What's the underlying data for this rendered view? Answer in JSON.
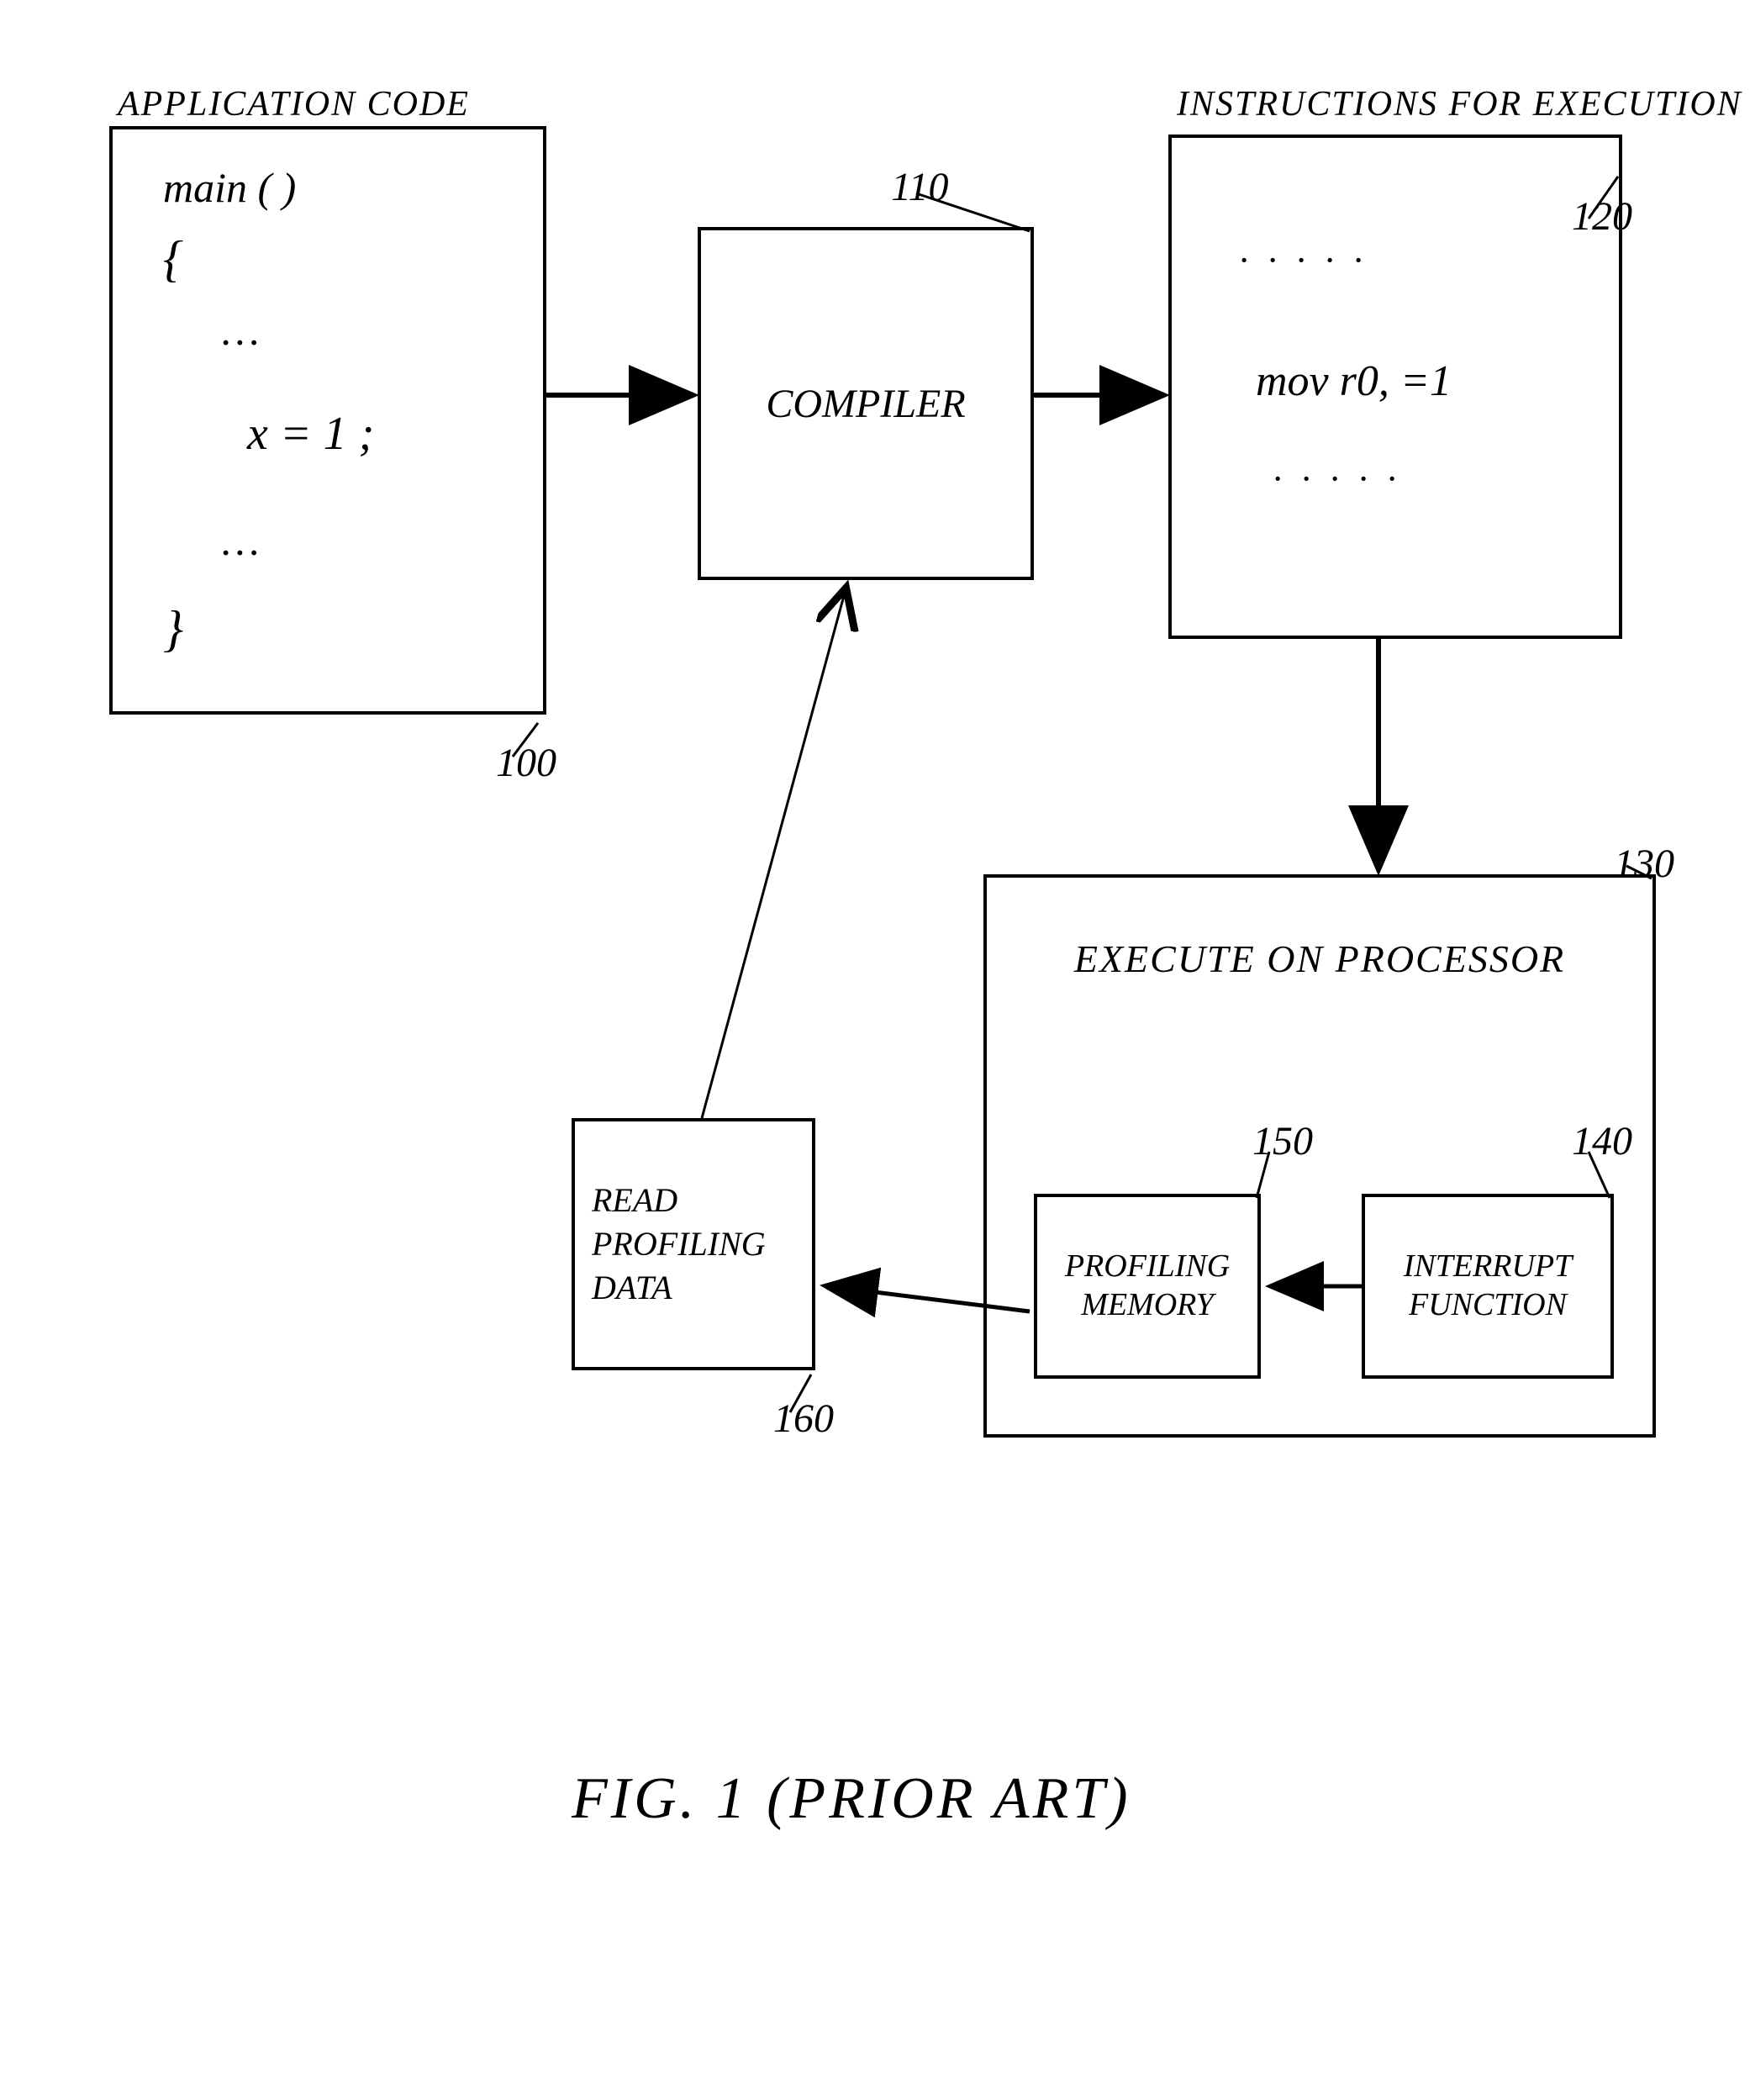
{
  "labels": {
    "app_code_title": "APPLICATION CODE",
    "instructions_title": "INSTRUCTIONS FOR EXECUTION"
  },
  "boxes": {
    "app_code": {
      "main_decl": "main ( )",
      "brace_open": "{",
      "dots1": "…",
      "assign": "x = 1 ;",
      "dots2": "…",
      "brace_close": "}"
    },
    "compiler": "COMPILER",
    "instructions": {
      "dots_top": "· · · · ·",
      "mov": "mov r0, =1",
      "dots_bot": "· · · · ·"
    },
    "processor_title": "EXECUTE ON PROCESSOR",
    "prof_mem": "PROFILING MEMORY",
    "interrupt": "INTERRUPT FUNCTION",
    "read_prof": "READ PROFILING DATA"
  },
  "refs": {
    "r100": "100",
    "r110": "110",
    "r120": "120",
    "r130": "130",
    "r140": "140",
    "r150": "150",
    "r160": "160"
  },
  "figure_caption": "FIG. 1  (PRIOR ART)"
}
